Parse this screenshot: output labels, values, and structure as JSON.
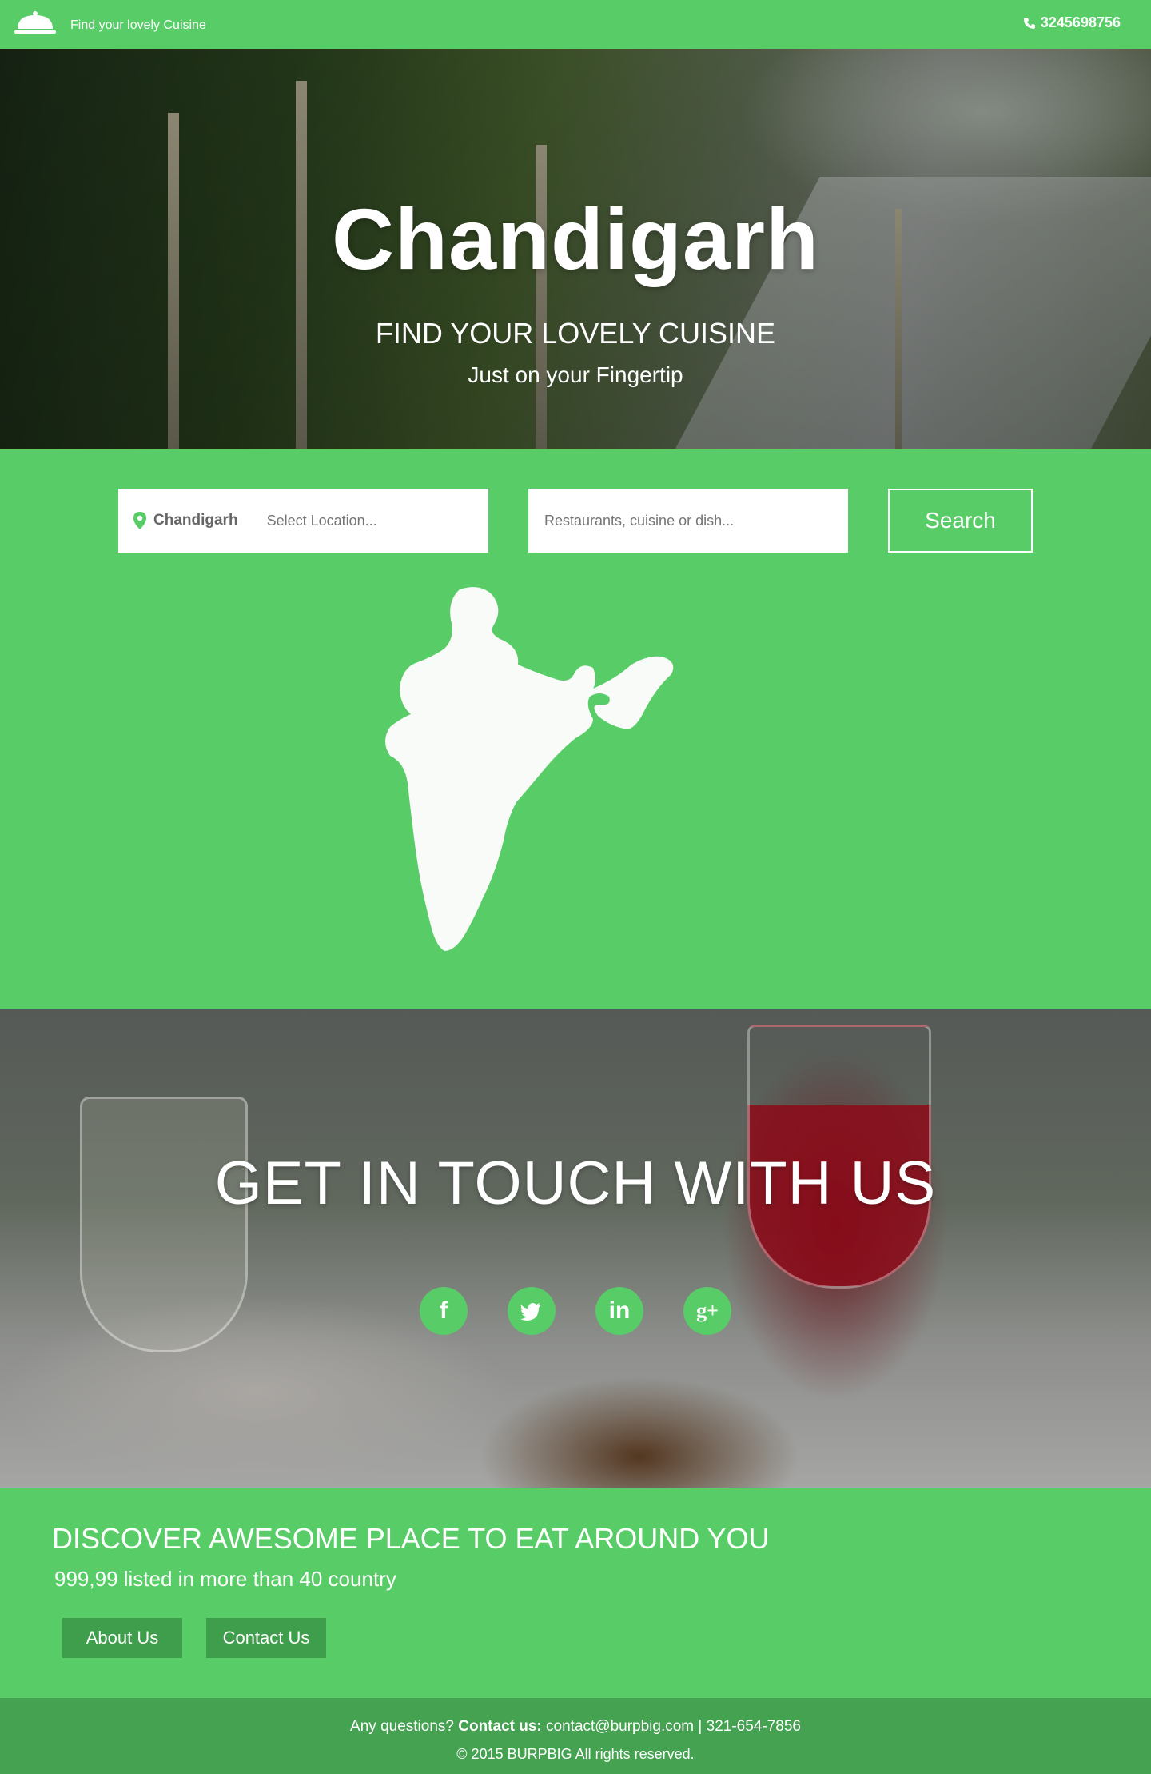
{
  "header": {
    "tagline": "Find your lovely Cuisine",
    "phone": "3245698756",
    "logo_icon": "cloche-icon",
    "phone_icon": "phone-icon"
  },
  "hero": {
    "title": "Chandigarh",
    "subtitle": "FIND YOUR LOVELY CUISINE",
    "tagline": "Just on your Fingertip"
  },
  "search": {
    "city": "Chandigarh",
    "location_placeholder": "Select Location...",
    "query_placeholder": "Restaurants, cuisine or dish...",
    "button_label": "Search",
    "pin_icon": "location-pin-icon"
  },
  "map": {
    "icon": "india-map-icon"
  },
  "contact": {
    "title": "GET IN TOUCH WITH US",
    "socials": [
      {
        "name": "facebook-icon",
        "glyph": "f"
      },
      {
        "name": "twitter-icon",
        "glyph": ""
      },
      {
        "name": "linkedin-icon",
        "glyph": "in"
      },
      {
        "name": "googleplus-icon",
        "glyph": "g+"
      }
    ]
  },
  "discover": {
    "title": "DISCOVER AWESOME PLACE TO EAT AROUND YOU",
    "subtitle": "999,99 listed in more than 40 country",
    "about_label": "About Us",
    "contact_label": "Contact Us"
  },
  "footer": {
    "questions": "Any questions?",
    "contact_label": "Contact us:",
    "contact_details": "contact@burpbig.com | 321-654-7856",
    "copyright": "©  2015 BURPBIG All rights reserved."
  },
  "colors": {
    "brand_green": "#58cc67",
    "dark_green": "#3f9e4b",
    "footer_green": "#44a250"
  }
}
